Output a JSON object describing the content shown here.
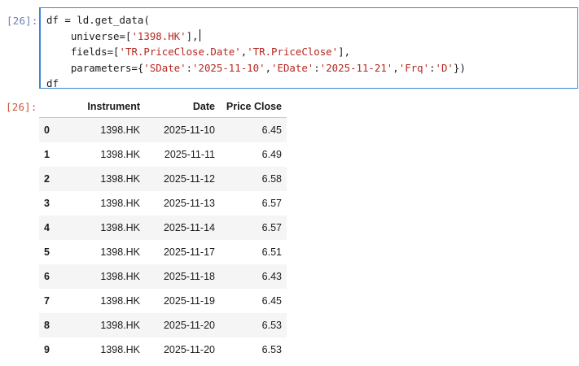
{
  "input_cell": {
    "prompt": "[26]:",
    "code_lines": [
      {
        "parts": [
          {
            "t": "df = ld.get_data(",
            "c": "op"
          }
        ]
      },
      {
        "parts": [
          {
            "t": "    universe=[",
            "c": "op"
          },
          {
            "t": "'1398.HK'",
            "c": "str"
          },
          {
            "t": "],",
            "c": "op"
          }
        ],
        "cursor": true
      },
      {
        "parts": [
          {
            "t": "    fields=[",
            "c": "op"
          },
          {
            "t": "'TR.PriceClose.Date'",
            "c": "str"
          },
          {
            "t": ",",
            "c": "op"
          },
          {
            "t": "'TR.PriceClose'",
            "c": "str"
          },
          {
            "t": "],",
            "c": "op"
          }
        ]
      },
      {
        "parts": [
          {
            "t": "    parameters={",
            "c": "op"
          },
          {
            "t": "'SDate'",
            "c": "str"
          },
          {
            "t": ":",
            "c": "op"
          },
          {
            "t": "'2025-11-10'",
            "c": "str"
          },
          {
            "t": ",",
            "c": "op"
          },
          {
            "t": "'EDate'",
            "c": "str"
          },
          {
            "t": ":",
            "c": "op"
          },
          {
            "t": "'2025-11-21'",
            "c": "str"
          },
          {
            "t": ",",
            "c": "op"
          },
          {
            "t": "'Frq'",
            "c": "str"
          },
          {
            "t": ":",
            "c": "op"
          },
          {
            "t": "'D'",
            "c": "str"
          },
          {
            "t": "})",
            "c": "op"
          }
        ]
      },
      {
        "parts": [
          {
            "t": "df",
            "c": "op"
          }
        ]
      }
    ]
  },
  "output_cell": {
    "prompt": "[26]:",
    "columns": [
      "",
      "Instrument",
      "Date",
      "Price Close"
    ],
    "rows": [
      [
        "0",
        "1398.HK",
        "2025-11-10",
        "6.45"
      ],
      [
        "1",
        "1398.HK",
        "2025-11-11",
        "6.49"
      ],
      [
        "2",
        "1398.HK",
        "2025-11-12",
        "6.58"
      ],
      [
        "3",
        "1398.HK",
        "2025-11-13",
        "6.57"
      ],
      [
        "4",
        "1398.HK",
        "2025-11-14",
        "6.57"
      ],
      [
        "5",
        "1398.HK",
        "2025-11-17",
        "6.51"
      ],
      [
        "6",
        "1398.HK",
        "2025-11-18",
        "6.43"
      ],
      [
        "7",
        "1398.HK",
        "2025-11-19",
        "6.45"
      ],
      [
        "8",
        "1398.HK",
        "2025-11-20",
        "6.53"
      ],
      [
        "9",
        "1398.HK",
        "2025-11-20",
        "6.53"
      ]
    ]
  },
  "colors": {
    "input_border": "#3d86d6",
    "string": "#b5271e",
    "in_prompt": "#6c7eb7",
    "out_prompt": "#c45a3c"
  }
}
